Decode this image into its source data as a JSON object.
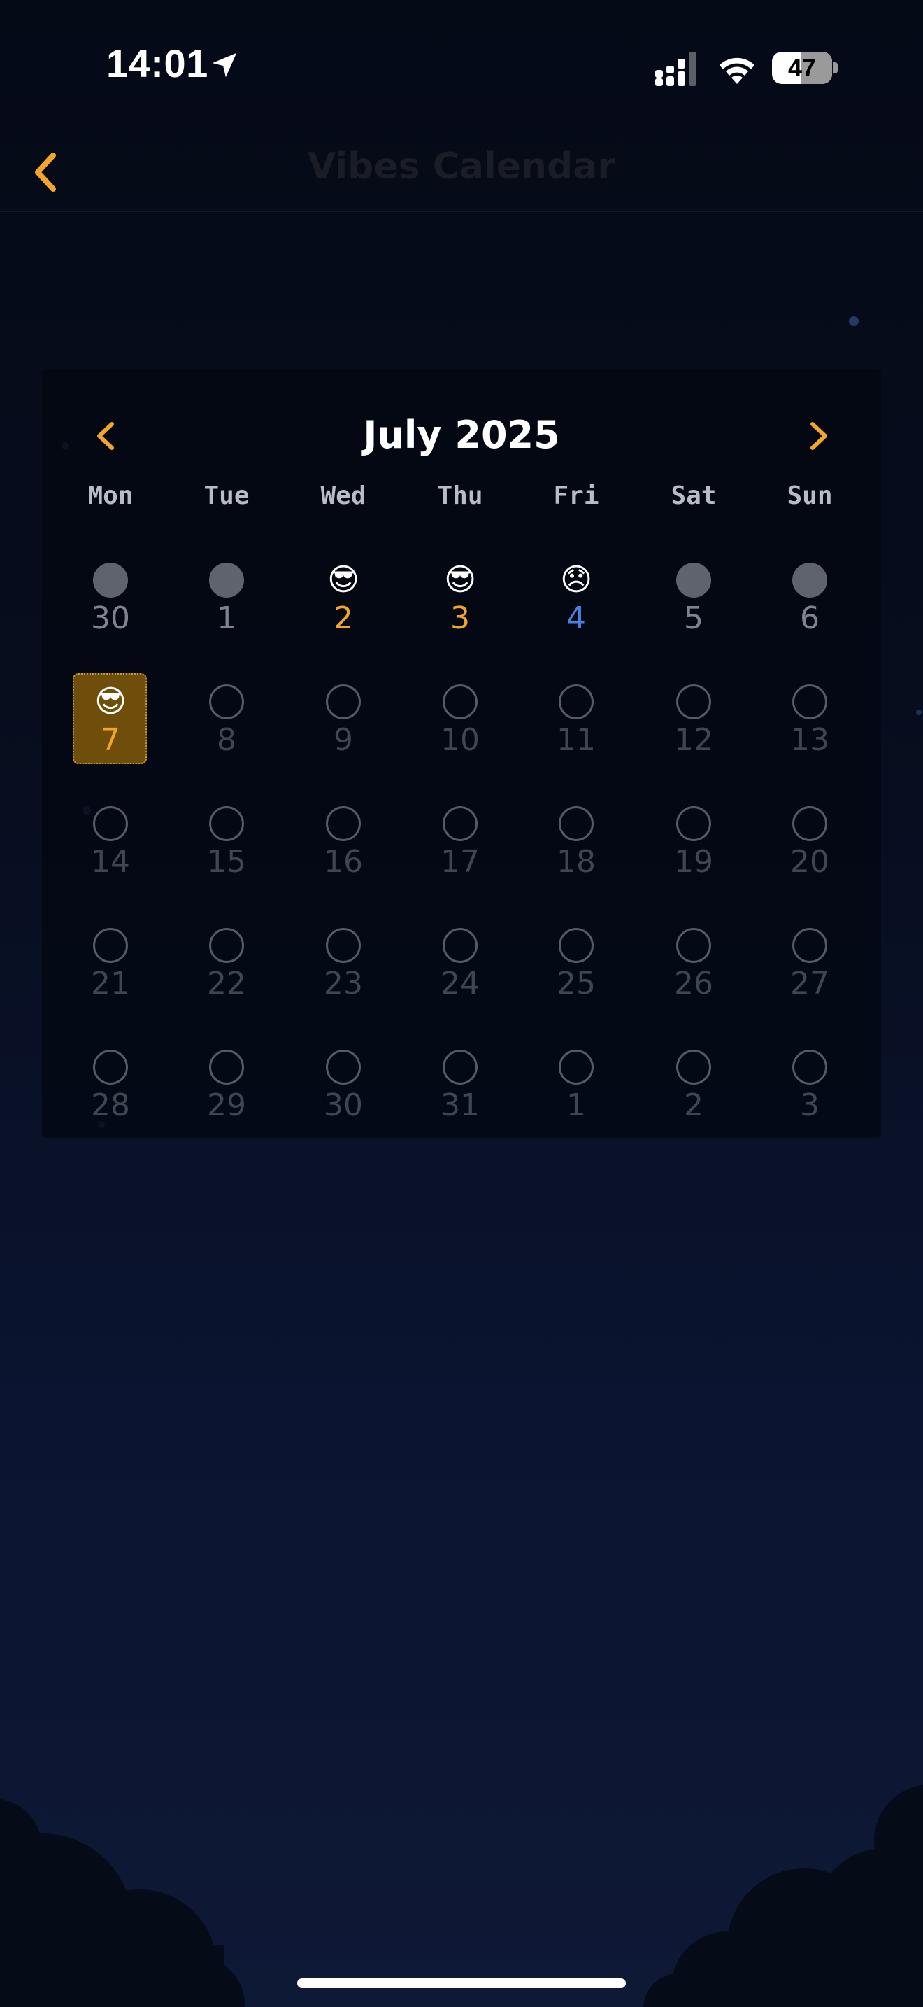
{
  "status_bar": {
    "time": "14:01",
    "battery_level": "47"
  },
  "nav": {
    "title": "Vibes Calendar"
  },
  "calendar": {
    "month_title": "July 2025",
    "weekdays": [
      "Mon",
      "Tue",
      "Wed",
      "Thu",
      "Fri",
      "Sat",
      "Sun"
    ],
    "moods": {
      "happy": "😎",
      "sad": "😞"
    },
    "weeks": [
      [
        {
          "day": "30",
          "state": "filled",
          "tone": "prev"
        },
        {
          "day": "1",
          "state": "filled",
          "tone": "prev"
        },
        {
          "day": "2",
          "state": "happy",
          "tone": "happy"
        },
        {
          "day": "3",
          "state": "happy",
          "tone": "happy"
        },
        {
          "day": "4",
          "state": "sad",
          "tone": "sad"
        },
        {
          "day": "5",
          "state": "filled",
          "tone": "prev"
        },
        {
          "day": "6",
          "state": "filled",
          "tone": "prev"
        }
      ],
      [
        {
          "day": "7",
          "state": "happy",
          "tone": "happy",
          "selected": true
        },
        {
          "day": "8",
          "state": "empty",
          "tone": "future"
        },
        {
          "day": "9",
          "state": "empty",
          "tone": "future"
        },
        {
          "day": "10",
          "state": "empty",
          "tone": "future"
        },
        {
          "day": "11",
          "state": "empty",
          "tone": "future"
        },
        {
          "day": "12",
          "state": "empty",
          "tone": "future"
        },
        {
          "day": "13",
          "state": "empty",
          "tone": "future"
        }
      ],
      [
        {
          "day": "14",
          "state": "empty",
          "tone": "future"
        },
        {
          "day": "15",
          "state": "empty",
          "tone": "future"
        },
        {
          "day": "16",
          "state": "empty",
          "tone": "future"
        },
        {
          "day": "17",
          "state": "empty",
          "tone": "future"
        },
        {
          "day": "18",
          "state": "empty",
          "tone": "future"
        },
        {
          "day": "19",
          "state": "empty",
          "tone": "future"
        },
        {
          "day": "20",
          "state": "empty",
          "tone": "future"
        }
      ],
      [
        {
          "day": "21",
          "state": "empty",
          "tone": "future"
        },
        {
          "day": "22",
          "state": "empty",
          "tone": "future"
        },
        {
          "day": "23",
          "state": "empty",
          "tone": "future"
        },
        {
          "day": "24",
          "state": "empty",
          "tone": "future"
        },
        {
          "day": "25",
          "state": "empty",
          "tone": "future"
        },
        {
          "day": "26",
          "state": "empty",
          "tone": "future"
        },
        {
          "day": "27",
          "state": "empty",
          "tone": "future"
        }
      ],
      [
        {
          "day": "28",
          "state": "empty",
          "tone": "future"
        },
        {
          "day": "29",
          "state": "empty",
          "tone": "future"
        },
        {
          "day": "30",
          "state": "empty",
          "tone": "future"
        },
        {
          "day": "31",
          "state": "empty",
          "tone": "future"
        },
        {
          "day": "1",
          "state": "empty",
          "tone": "future"
        },
        {
          "day": "2",
          "state": "empty",
          "tone": "future"
        },
        {
          "day": "3",
          "state": "empty",
          "tone": "future"
        }
      ]
    ]
  },
  "colors": {
    "accent": "#f2a42b",
    "sad": "#4a7fe0",
    "selected_bg": "#6f4e0c"
  },
  "icons": {
    "back": "chevron-left-icon",
    "prev_month": "chevron-left-icon",
    "next_month": "chevron-right-icon",
    "location": "location-arrow-icon",
    "signal": "cellular-signal-icon",
    "wifi": "wifi-icon",
    "battery": "battery-icon"
  }
}
